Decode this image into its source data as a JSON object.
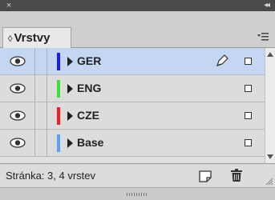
{
  "window": {
    "close_glyph": "×",
    "collapse_glyph": "◂◂"
  },
  "tab": {
    "arrows": "◊",
    "title": "Vrstvy"
  },
  "panel_menu_icon": "panel-menu-icon",
  "layers": [
    {
      "name": "GER",
      "color": "#1a1aff",
      "visible": true,
      "selected": true,
      "editing": true
    },
    {
      "name": "ENG",
      "color": "#33e633",
      "visible": true,
      "selected": false,
      "editing": false
    },
    {
      "name": "CZE",
      "color": "#ff1a1a",
      "visible": true,
      "selected": false,
      "editing": false
    },
    {
      "name": "Base",
      "color": "#5aa0ff",
      "visible": true,
      "selected": false,
      "editing": false
    }
  ],
  "footer": {
    "status": "Stránka: 3, 4 vrstev"
  }
}
